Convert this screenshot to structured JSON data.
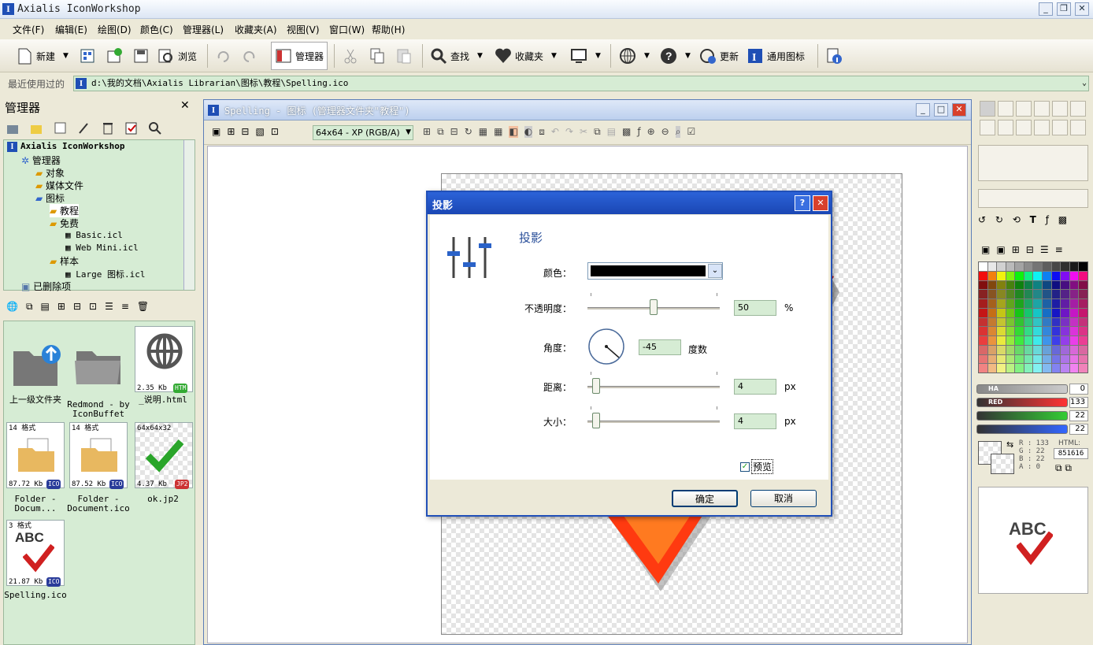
{
  "app": {
    "title": "Axialis IconWorkshop"
  },
  "menu": [
    "文件(F)",
    "编辑(E)",
    "绘图(D)",
    "颜色(C)",
    "管理器(L)",
    "收藏夹(A)",
    "视图(V)",
    "窗口(W)",
    "帮助(H)"
  ],
  "toolbar": {
    "new": "新建",
    "browse": "浏览",
    "manager": "管理器",
    "find": "查找",
    "favorites": "收藏夹",
    "update": "更新",
    "generic_icons": "通用图标"
  },
  "address": {
    "label": "最近使用过的",
    "path": "d:\\我的文档\\Axialis Librarian\\图标\\教程\\Spelling.ico"
  },
  "manager_panel": {
    "title": "管理器"
  },
  "tree": {
    "root": "Axialis IconWorkshop",
    "manager": "管理器",
    "objects": "对象",
    "media": "媒体文件",
    "icons": "图标",
    "tutorial": "教程",
    "free": "免费",
    "basic": "Basic.icl",
    "webmini": "Web Mini.icl",
    "samples": "样本",
    "large": "Large 图标.icl",
    "deleted": "已删除项"
  },
  "files": [
    {
      "name": "上一级文件夹",
      "meta": "",
      "size": "",
      "badge": ""
    },
    {
      "name": "Redmond - by IconBuffet",
      "meta": "",
      "size": "",
      "badge": ""
    },
    {
      "name": "_说明.html",
      "meta": "",
      "size": "2.35 Kb",
      "badge": "HTM"
    },
    {
      "name": "Folder - Docum...",
      "meta": "14 格式",
      "size": "87.72 Kb",
      "badge": "ICO"
    },
    {
      "name": "Folder - Document.ico",
      "meta": "14 格式",
      "size": "87.52 Kb",
      "badge": "ICO"
    },
    {
      "name": "ok.jp2",
      "meta": "64x64x32",
      "size": "4.37 Kb",
      "badge": "JP2"
    },
    {
      "name": "Spelling.ico",
      "meta": "3 格式",
      "size": "21.87 Kb",
      "badge": "ICO"
    }
  ],
  "doc_window": {
    "title": "Spelling - 图标 (管理器文件夹\"教程\")",
    "format": "64x64 - XP (RGB/A)"
  },
  "dialog": {
    "title": "投影",
    "heading": "投影",
    "color_label": "颜色：",
    "opacity_label": "不透明度：",
    "opacity_value": "50",
    "opacity_unit": "%",
    "angle_label": "角度：",
    "angle_value": "-45",
    "angle_unit": "度数",
    "distance_label": "距离：",
    "distance_value": "4",
    "distance_unit": "px",
    "size_label": "大小：",
    "size_value": "4",
    "size_unit": "px",
    "preview_label": "预览",
    "preview_checked": true,
    "ok": "确定",
    "cancel": "取消",
    "opacity_fraction": 0.5
  },
  "color_panel": {
    "slider_labels": [
      "HA",
      "RED",
      "",
      ""
    ],
    "slider_values": [
      "0",
      "133",
      "22",
      "22"
    ],
    "rgba": "R : 133\nG : 22\nB : 22\nA : 0",
    "html_label": "HTML:",
    "html_value": "851616",
    "preview_text": "ABC"
  }
}
